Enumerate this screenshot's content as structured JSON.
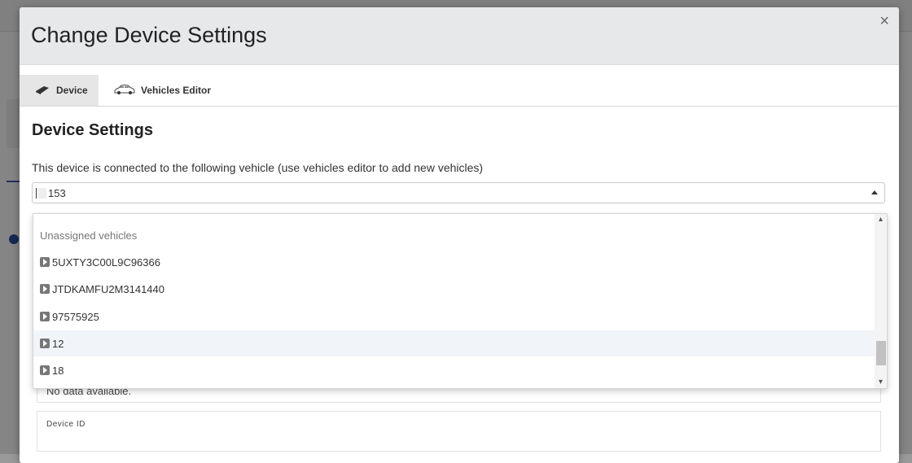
{
  "modal": {
    "title": "Change Device Settings",
    "close_glyph": "×"
  },
  "tabs": [
    {
      "label": "Device",
      "icon": "device-icon",
      "active": true
    },
    {
      "label": "Vehicles Editor",
      "icon": "car-icon",
      "active": false
    }
  ],
  "settings": {
    "section_title": "Device Settings",
    "description": "This device is connected to the following vehicle (use vehicles editor to add new vehicles)",
    "selected_vehicle": "153"
  },
  "dropdown": {
    "group_label": "Unassigned vehicles",
    "options": [
      {
        "label": "5UXTY3C00L9C96366"
      },
      {
        "label": "JTDKAMFU2M3141440"
      },
      {
        "label": "97575925"
      },
      {
        "label": "12",
        "hovered": true
      },
      {
        "label": "18"
      }
    ],
    "scroll_up_glyph": "▴",
    "scroll_down_glyph": "▾"
  },
  "fields": {
    "no_data": "No data available.",
    "device_id_label": "Device ID"
  },
  "colors": {
    "header_bg": "#e7e8ea",
    "active_tab_bg": "#e6e6e6",
    "hover_row_bg": "#f1f5fa"
  }
}
